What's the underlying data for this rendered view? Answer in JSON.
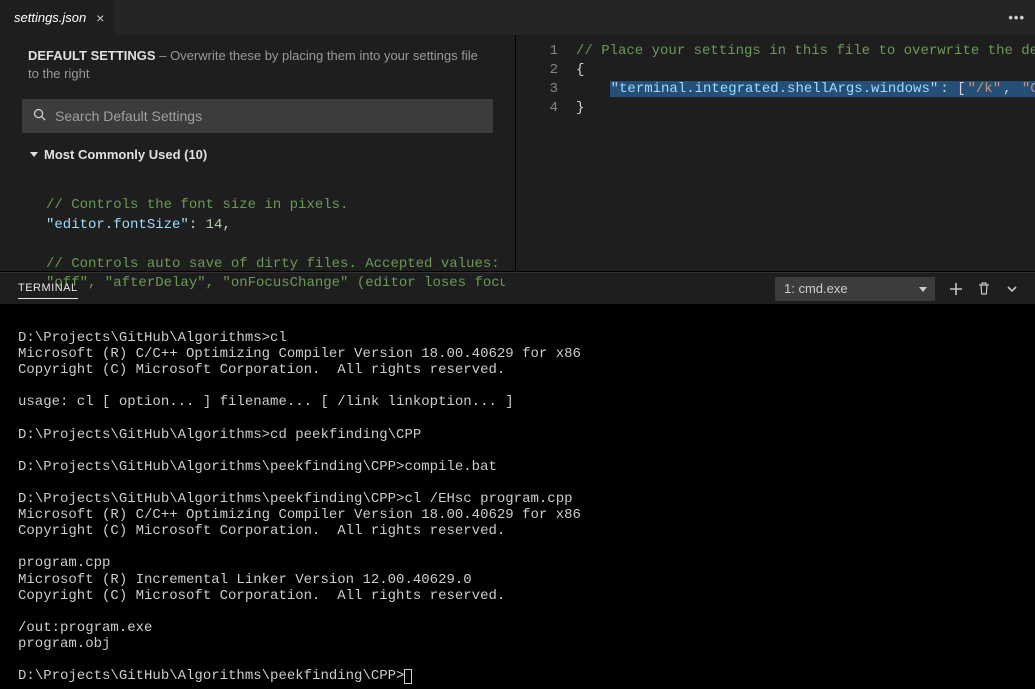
{
  "tab": {
    "title": "settings.json"
  },
  "left": {
    "banner_bold": "DEFAULT SETTINGS",
    "banner_rest": " – Overwrite these by placing them into your settings file to the right",
    "search_placeholder": "Search Default Settings",
    "section_title": "Most Commonly Used (10)",
    "code": {
      "comment1": "// Controls the font size in pixels.",
      "key1": "\"editor.fontSize\"",
      "val1": "14",
      "comment2": "// Controls auto save of dirty files. Accepted values:",
      "comment3": "\"off\", \"afterDelay\", \"onFocusChange\" (editor loses focus)"
    }
  },
  "right": {
    "gutter": [
      "1",
      "2",
      "3",
      "4"
    ],
    "line1_comment": "// Place your settings in this file to overwrite the defau",
    "line2": "{",
    "line3_key": "\"terminal.integrated.shellArgs.windows\"",
    "line3_colon_bracket": ": [",
    "line3_str1": "\"/k\"",
    "line3_comma": ", ",
    "line3_str2": "\"C:\\\\P",
    "line4": "}"
  },
  "panel": {
    "title": "TERMINAL",
    "select_value": "1: cmd.exe"
  },
  "terminal_lines": [
    "",
    "D:\\Projects\\GitHub\\Algorithms>cl",
    "Microsoft (R) C/C++ Optimizing Compiler Version 18.00.40629 for x86",
    "Copyright (C) Microsoft Corporation.  All rights reserved.",
    "",
    "usage: cl [ option... ] filename... [ /link linkoption... ]",
    "",
    "D:\\Projects\\GitHub\\Algorithms>cd peekfinding\\CPP",
    "",
    "D:\\Projects\\GitHub\\Algorithms\\peekfinding\\CPP>compile.bat",
    "",
    "D:\\Projects\\GitHub\\Algorithms\\peekfinding\\CPP>cl /EHsc program.cpp",
    "Microsoft (R) C/C++ Optimizing Compiler Version 18.00.40629 for x86",
    "Copyright (C) Microsoft Corporation.  All rights reserved.",
    "",
    "program.cpp",
    "Microsoft (R) Incremental Linker Version 12.00.40629.0",
    "Copyright (C) Microsoft Corporation.  All rights reserved.",
    "",
    "/out:program.exe",
    "program.obj",
    "",
    "D:\\Projects\\GitHub\\Algorithms\\peekfinding\\CPP>"
  ]
}
